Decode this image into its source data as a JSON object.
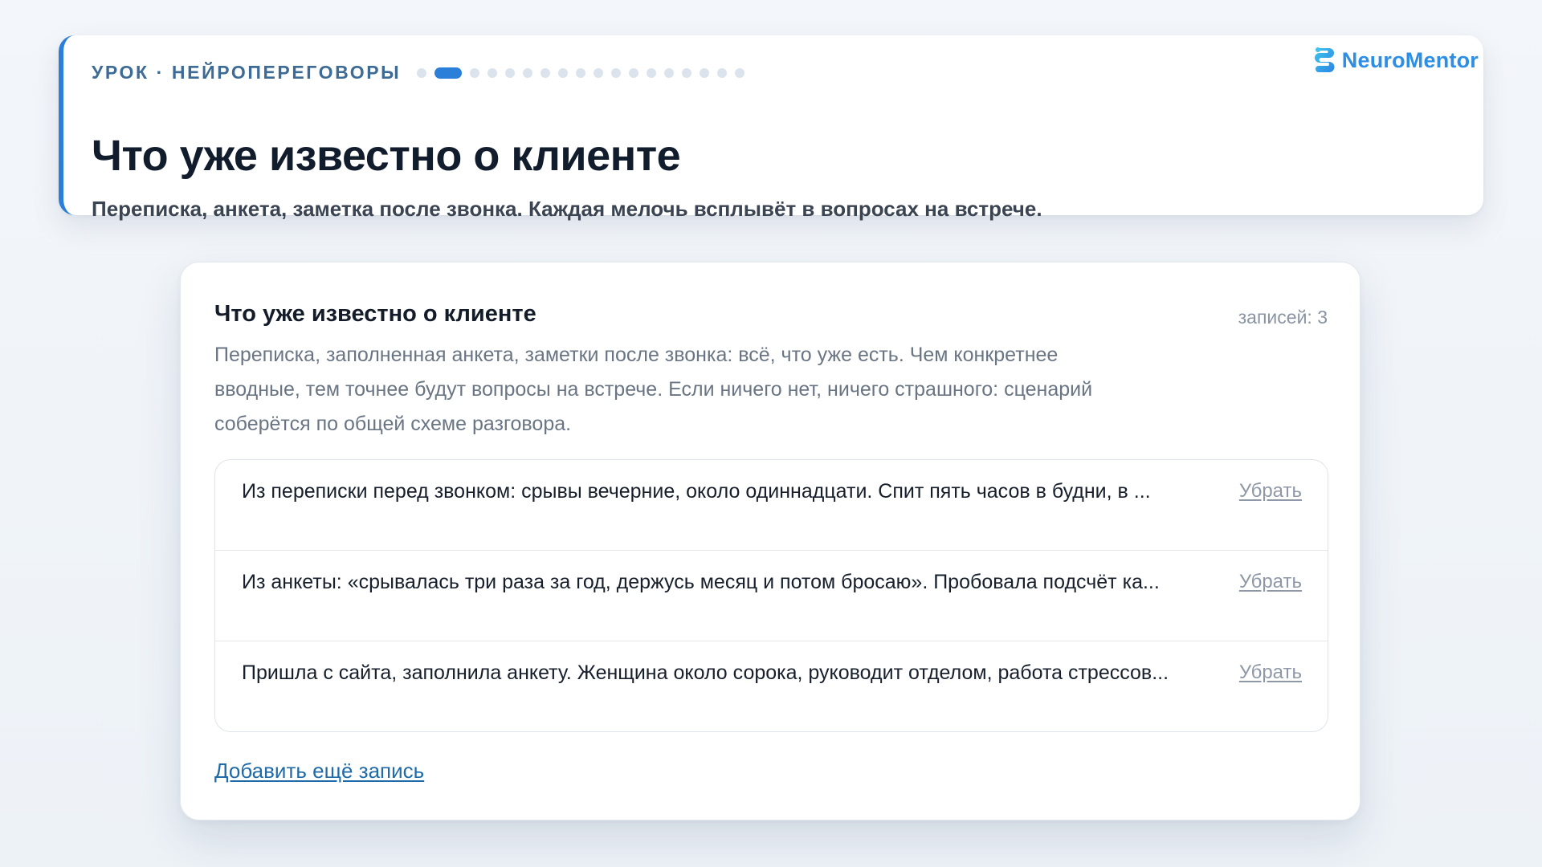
{
  "header": {
    "kicker": "УРОК · НЕЙРОПЕРЕГОВОРЫ",
    "title": "Что уже известно о клиенте",
    "subtitle": "Переписка, анкета, заметка после звонка. Каждая мелочь всплывёт в вопросах на встрече.",
    "progress": {
      "total_steps": 18,
      "current_step": 2
    }
  },
  "brand": {
    "name": "NeuroMentor",
    "logo_icon": "neuromentor-logo-icon",
    "color": "#2d8ee6"
  },
  "panel": {
    "title": "Что уже известно о клиенте",
    "count_label": "записей: 3",
    "description": "Переписка, заполненная анкета, заметки после звонка: всё, что уже есть. Чем конкретнее вводные, тем точнее будут вопросы на встрече. Если ничего нет, ничего страшного: сценарий соберётся по общей схеме разговора.",
    "notes": [
      {
        "text": "Из переписки перед звонком: срывы вечерние, около одиннадцати. Спит пять часов в будни, в ...",
        "remove_label": "Убрать"
      },
      {
        "text": "Из анкеты: «срывалась три раза за год, держусь месяц и потом бросаю». Пробовала подсчёт ка...",
        "remove_label": "Убрать"
      },
      {
        "text": "Пришла с сайта, заполнила анкету. Женщина около сорока, руководит отделом, работа стрессов...",
        "remove_label": "Убрать"
      }
    ],
    "add_label": "Добавить ещё запись"
  },
  "colors": {
    "accent": "#2b7fd9",
    "link": "#1f6aa8",
    "muted": "#8a94a2",
    "background": "#f1f5f9"
  }
}
